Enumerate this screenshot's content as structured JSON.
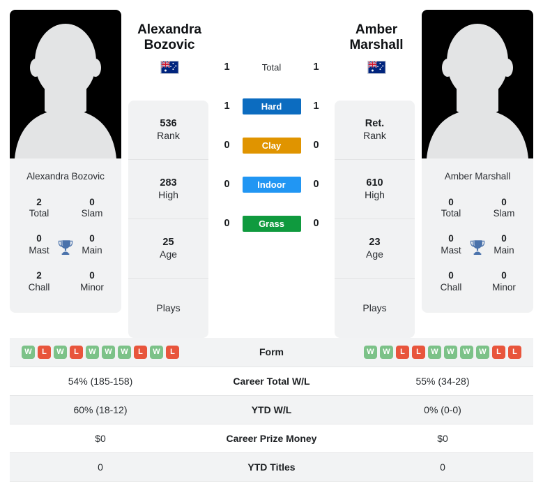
{
  "players": {
    "left": {
      "first_name": "Alexandra",
      "last_name": "Bozovic",
      "full_name": "Alexandra Bozovic",
      "country": "Australia",
      "flag": "au-flag-icon",
      "avatar": "player-placeholder-avatar",
      "titles": [
        {
          "value": "2",
          "label": "Total"
        },
        {
          "value": "0",
          "label": "Slam"
        },
        {
          "value": "0",
          "label": "Mast"
        },
        {
          "value": "0",
          "label": "Main"
        },
        {
          "value": "2",
          "label": "Chall"
        },
        {
          "value": "0",
          "label": "Minor"
        }
      ],
      "meta": [
        {
          "value": "536",
          "label": "Rank"
        },
        {
          "value": "283",
          "label": "High"
        },
        {
          "value": "25",
          "label": "Age"
        },
        {
          "value": "",
          "label": "Plays"
        }
      ],
      "form": [
        "W",
        "L",
        "W",
        "L",
        "W",
        "W",
        "W",
        "L",
        "W",
        "L"
      ]
    },
    "right": {
      "first_name": "Amber",
      "last_name": "Marshall",
      "full_name": "Amber Marshall",
      "country": "Australia",
      "flag": "au-flag-icon",
      "avatar": "player-placeholder-avatar",
      "titles": [
        {
          "value": "0",
          "label": "Total"
        },
        {
          "value": "0",
          "label": "Slam"
        },
        {
          "value": "0",
          "label": "Mast"
        },
        {
          "value": "0",
          "label": "Main"
        },
        {
          "value": "0",
          "label": "Chall"
        },
        {
          "value": "0",
          "label": "Minor"
        }
      ],
      "meta": [
        {
          "value": "Ret.",
          "label": "Rank"
        },
        {
          "value": "610",
          "label": "High"
        },
        {
          "value": "23",
          "label": "Age"
        },
        {
          "value": "",
          "label": "Plays"
        }
      ],
      "form": [
        "W",
        "W",
        "L",
        "L",
        "W",
        "W",
        "W",
        "W",
        "L",
        "L"
      ]
    }
  },
  "h2h": [
    {
      "surface": "Total",
      "left": "1",
      "right": "1",
      "color": "",
      "plain": true
    },
    {
      "surface": "Hard",
      "left": "1",
      "right": "1",
      "color": "#0c6cc0",
      "plain": false
    },
    {
      "surface": "Clay",
      "left": "0",
      "right": "0",
      "color": "#e09400",
      "plain": false
    },
    {
      "surface": "Indoor",
      "left": "0",
      "right": "0",
      "color": "#2196f3",
      "plain": false
    },
    {
      "surface": "Grass",
      "left": "0",
      "right": "0",
      "color": "#0f9a3e",
      "plain": false
    }
  ],
  "table": {
    "rows": [
      {
        "label": "Form",
        "left": "",
        "right": "",
        "is_form": true
      },
      {
        "label": "Career Total W/L",
        "left": "54% (185-158)",
        "right": "55% (34-28)",
        "is_form": false
      },
      {
        "label": "YTD W/L",
        "left": "60% (18-12)",
        "right": "0% (0-0)",
        "is_form": false
      },
      {
        "label": "Career Prize Money",
        "left": "$0",
        "right": "$0",
        "is_form": false
      },
      {
        "label": "YTD Titles",
        "left": "0",
        "right": "0",
        "is_form": false
      }
    ]
  },
  "colors": {
    "hard": "#0c6cc0",
    "clay": "#e09400",
    "indoor": "#2196f3",
    "grass": "#0f9a3e",
    "win": "#7cc288",
    "loss": "#e8553c",
    "trophy": "#4a72ab",
    "card_bg": "#f1f2f3"
  },
  "icons": {
    "trophy": "trophy-icon",
    "flag": "flag-icon",
    "avatar": "avatar-silhouette-icon"
  }
}
